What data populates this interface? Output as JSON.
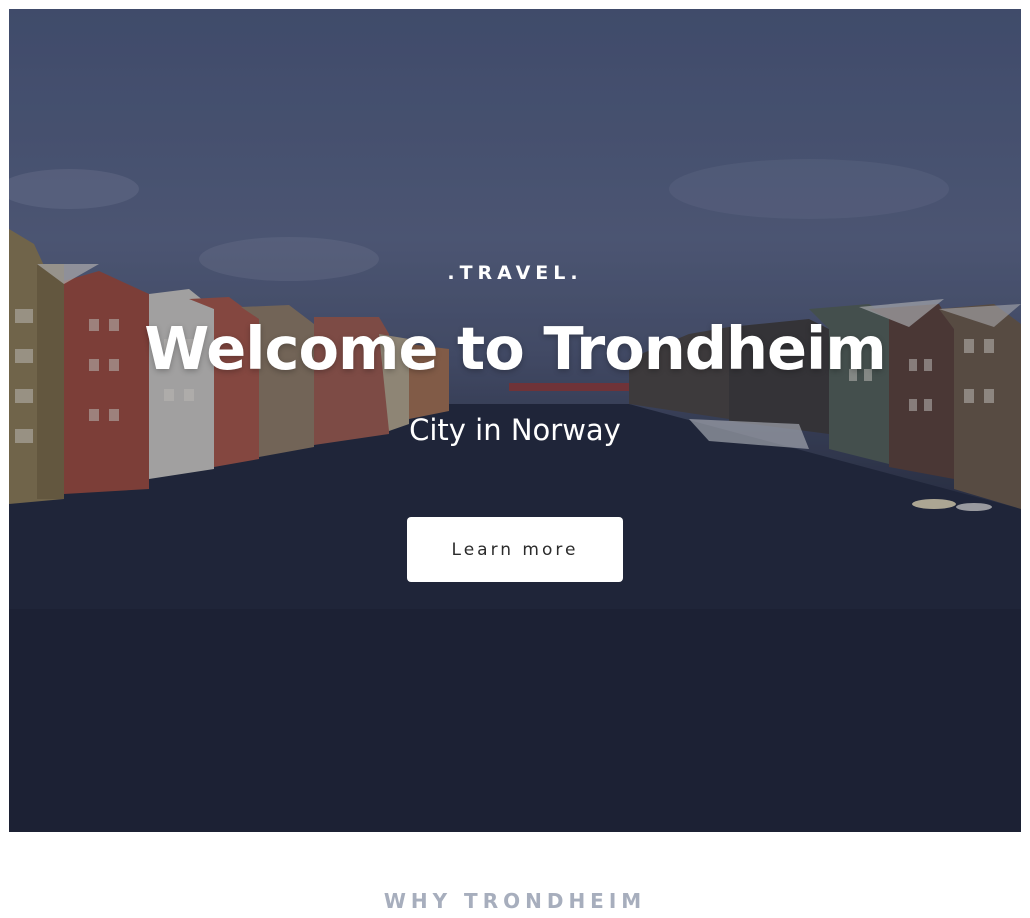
{
  "hero": {
    "eyebrow": ".TRAVEL.",
    "title": "Welcome to Trondheim",
    "subtitle": "City in Norway",
    "cta_label": "Learn more"
  },
  "section": {
    "label": "WHY TRONDHEIM"
  }
}
